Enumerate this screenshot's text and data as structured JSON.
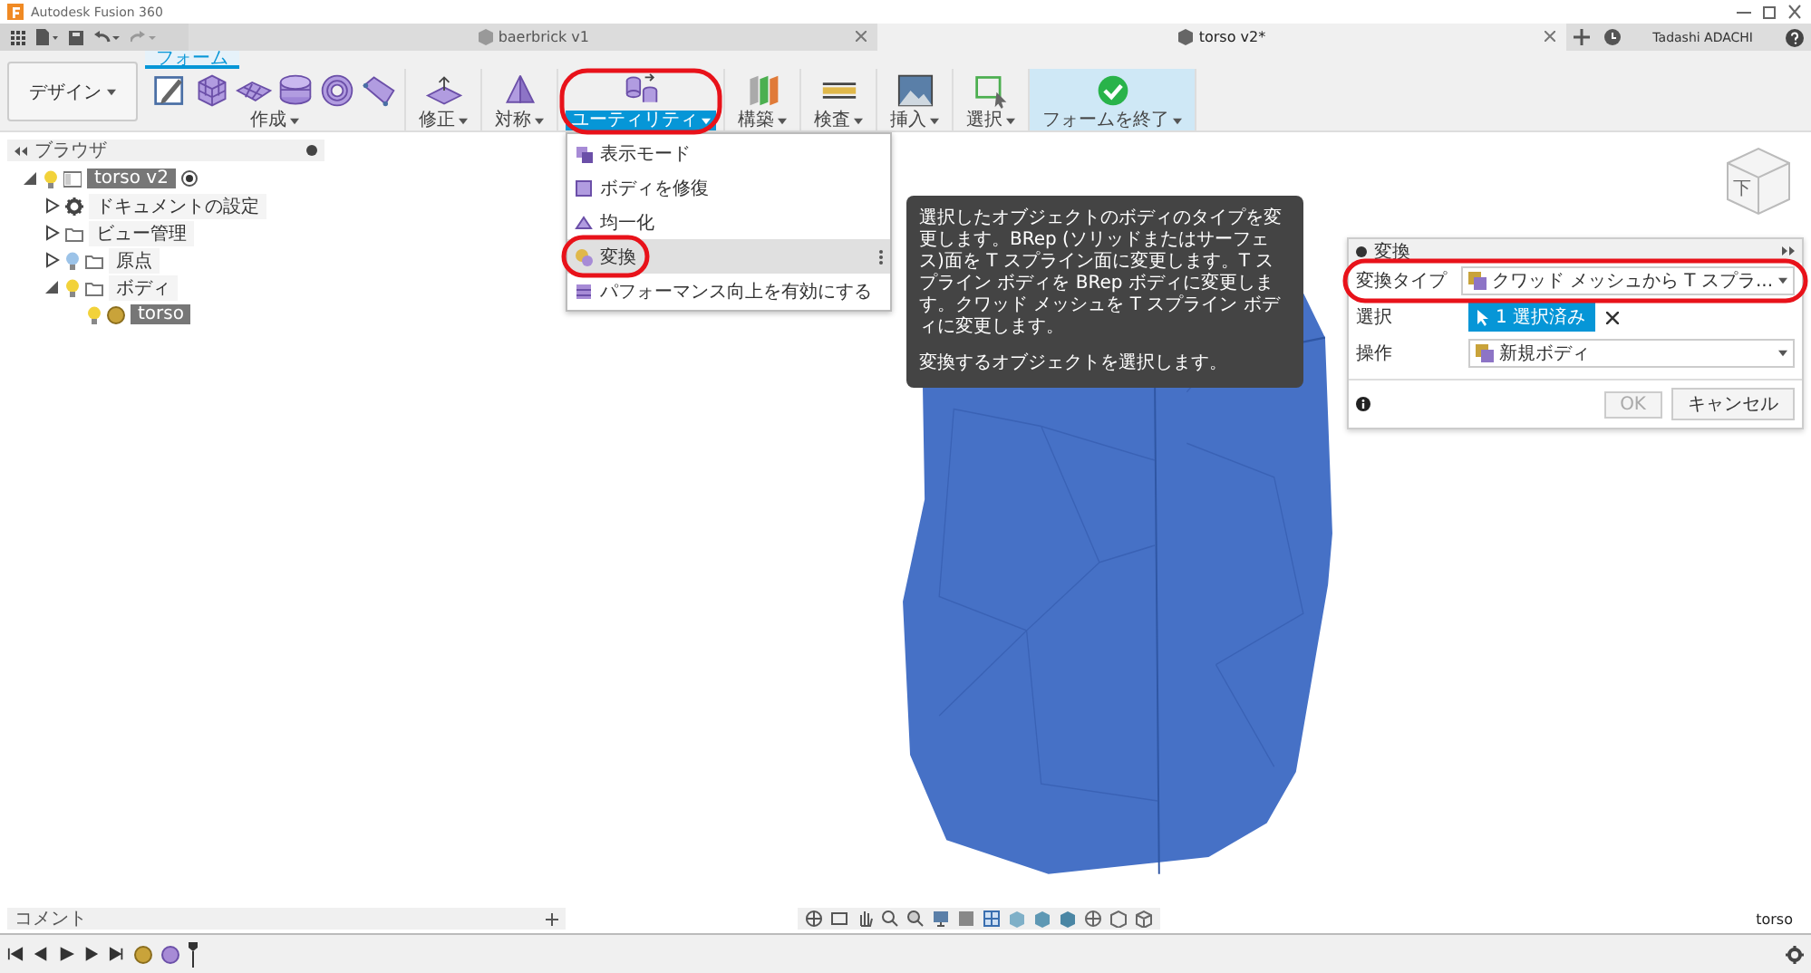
{
  "window": {
    "title": "Autodesk Fusion 360"
  },
  "document_tabs": [
    {
      "label": "baerbrick v1",
      "selected": false
    },
    {
      "label": "torso v2*",
      "selected": true
    }
  ],
  "user": {
    "name": "Tadashi ADACHI"
  },
  "workspace": {
    "label": "デザイン"
  },
  "ribbon": {
    "tabs": [
      {
        "label": "フォーム",
        "selected": true
      }
    ],
    "groups": [
      {
        "label": "作成",
        "selected": false
      },
      {
        "label": "修正",
        "selected": false
      },
      {
        "label": "対称",
        "selected": false
      },
      {
        "label": "ユーティリティ",
        "selected": true
      },
      {
        "label": "構築",
        "selected": false
      },
      {
        "label": "検査",
        "selected": false
      },
      {
        "label": "挿入",
        "selected": false
      },
      {
        "label": "選択",
        "selected": false
      },
      {
        "label": "フォームを終了",
        "selected": false
      }
    ]
  },
  "utility_menu": {
    "items": [
      {
        "label": "表示モード",
        "selected": false
      },
      {
        "label": "ボディを修復",
        "selected": false
      },
      {
        "label": "均一化",
        "selected": false
      },
      {
        "label": "変換",
        "selected": true
      },
      {
        "label": "パフォーマンス向上を有効にする",
        "selected": false
      }
    ]
  },
  "tooltip": {
    "paragraphs": [
      "選択したオブジェクトのボディのタイプを変更します。BRep (ソリッドまたはサーフェス)面を T スプライン面に変更します。T スプライン ボディを BRep ボディに変更します。クワッド メッシュを T スプライン ボディに変更します。",
      "変換するオブジェクトを選択します。"
    ]
  },
  "browser": {
    "title": "ブラウザ",
    "tree": [
      {
        "label": "torso v2",
        "kind": "component",
        "expanded": true,
        "visible": true,
        "selected": true,
        "children": [
          {
            "label": "ドキュメントの設定",
            "kind": "settings",
            "expanded": false,
            "selected": false
          },
          {
            "label": "ビュー管理",
            "kind": "folder",
            "expanded": false,
            "selected": false
          },
          {
            "label": "原点",
            "kind": "folder",
            "expanded": false,
            "visible": false,
            "selected": false
          },
          {
            "label": "ボディ",
            "kind": "folder",
            "expanded": true,
            "visible": true,
            "selected": false,
            "children": [
              {
                "label": "torso",
                "kind": "body",
                "visible": true,
                "selected": true
              }
            ]
          }
        ]
      }
    ]
  },
  "view_cube": {
    "label": "下"
  },
  "convert_panel": {
    "title": "変換",
    "rows": [
      {
        "label": "変換タイプ",
        "kind": "dropdown",
        "value": "クワッド メッシュから T スプラ..."
      },
      {
        "label": "選択",
        "kind": "selection",
        "value": "1 選択済み"
      },
      {
        "label": "操作",
        "kind": "dropdown",
        "value": "新規ボディ"
      }
    ],
    "buttons": [
      {
        "label": "OK",
        "disabled": true
      },
      {
        "label": "キャンセル",
        "disabled": false
      }
    ]
  },
  "comments": {
    "label": "コメント"
  },
  "status": {
    "label": "torso"
  }
}
